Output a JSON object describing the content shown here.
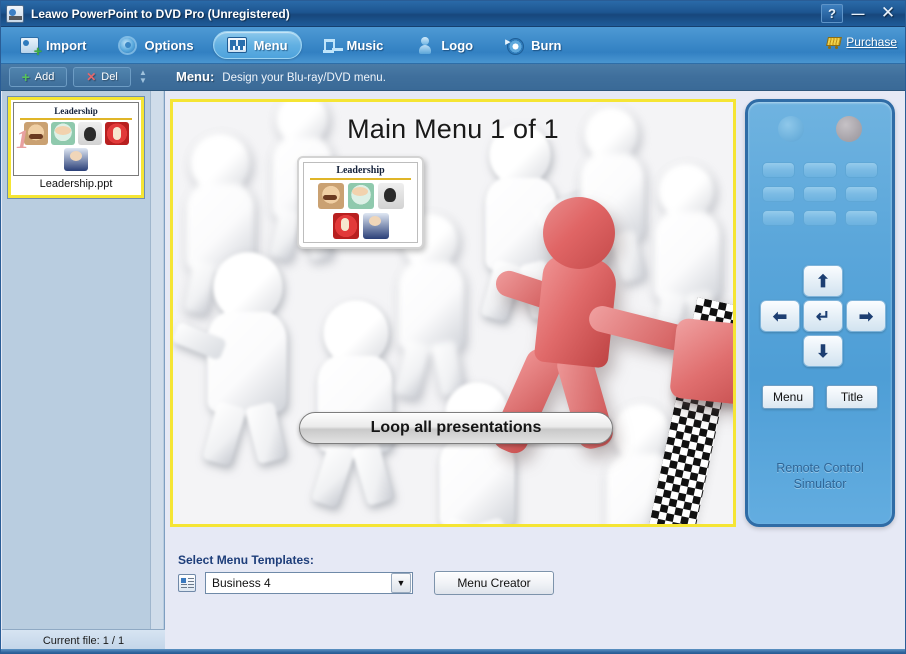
{
  "window": {
    "title": "Leawo PowerPoint to DVD Pro (Unregistered)",
    "app_icon": "slide-app-icon",
    "controls": {
      "help": "?",
      "minimize": "—",
      "close": "✕"
    }
  },
  "toolbar": {
    "items": [
      {
        "label": "Import",
        "icon": "import-slide-icon",
        "active": false
      },
      {
        "label": "Options",
        "icon": "gear-icon",
        "active": false
      },
      {
        "label": "Menu",
        "icon": "menu-grid-icon",
        "active": true
      },
      {
        "label": "Music",
        "icon": "music-note-icon",
        "active": false
      },
      {
        "label": "Logo",
        "icon": "person-icon",
        "active": false
      },
      {
        "label": "Burn",
        "icon": "burn-disc-icon",
        "active": false
      }
    ],
    "purchase": {
      "label": "Purchase",
      "icon": "shopping-cart-icon"
    }
  },
  "subbar": {
    "add_label": "Add",
    "del_label": "Del",
    "add_icon": "plus-icon",
    "del_icon": "cross-icon",
    "spinner_icon": "up-down-spinner-icon",
    "caption_key": "Menu:",
    "caption_value": "Design your Blu-ray/DVD menu."
  },
  "sidebar": {
    "thumbnail": {
      "slide_title": "Leadership",
      "slide_number": "1",
      "file_label": "Leadership.ppt"
    },
    "status": "Current file: 1 / 1"
  },
  "preview": {
    "menu_title": "Main Menu 1 of 1",
    "slide_thumb_title": "Leadership",
    "loop_button": "Loop all presentations"
  },
  "remote": {
    "caption_line1": "Remote Control",
    "caption_line2": "Simulator",
    "keypad_rows": 3,
    "keypad_cols": 3,
    "dpad": {
      "up": "⬆",
      "left": "⬅",
      "ok": "↵",
      "right": "➡",
      "down": "⬇"
    },
    "menu_button": "Menu",
    "title_button": "Title"
  },
  "templates": {
    "label": "Select Menu Templates:",
    "icon": "template-list-icon",
    "selected": "Business 4",
    "dropdown_arrow": "▼",
    "menu_creator_button": "Menu Creator"
  },
  "colors": {
    "titlebar": "#1d5590",
    "toolbar": "#3e8bca",
    "subbar": "#3f6f9c",
    "sidebar": "#b9cde0",
    "page_bg": "#e6e9f5",
    "selection_yellow": "#f5e534",
    "accent_red": "#e06565",
    "remote_blue": "#5aa6da"
  }
}
